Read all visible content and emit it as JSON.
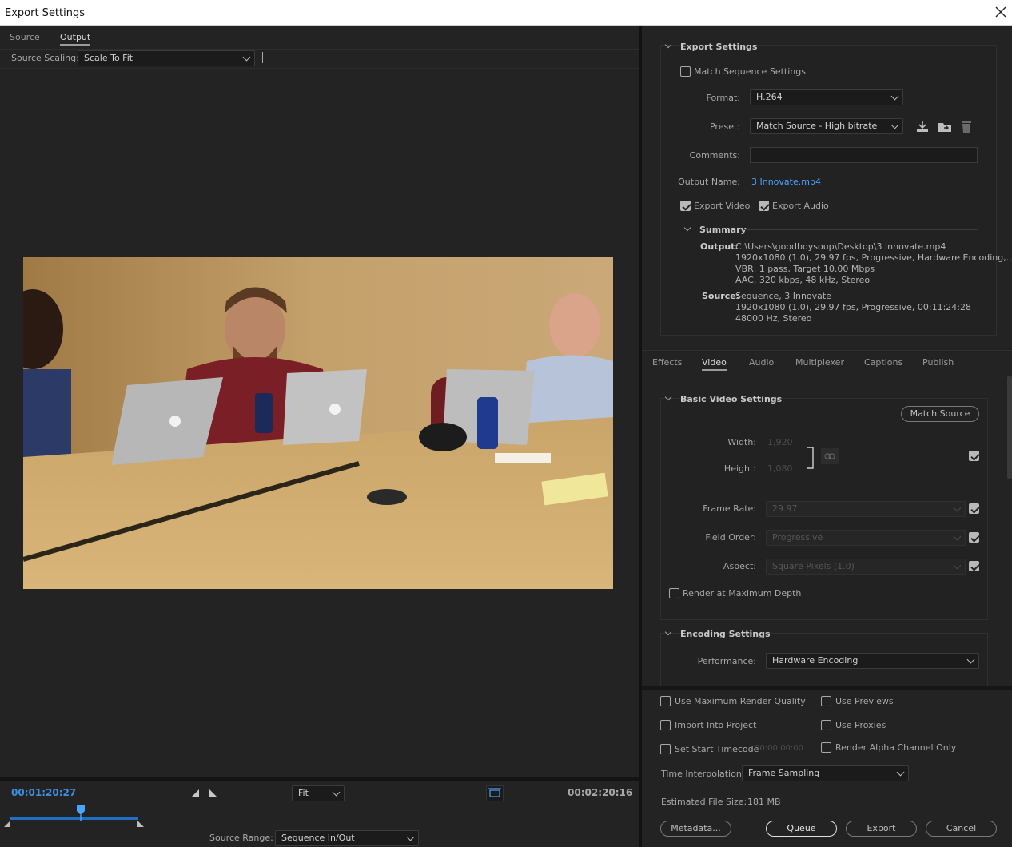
{
  "window": {
    "title": "Export Settings"
  },
  "left": {
    "tabs": [
      {
        "label": "Source",
        "active": false
      },
      {
        "label": "Output",
        "active": true
      }
    ],
    "source_scaling_label": "Source Scaling:",
    "source_scaling_value": "Scale To Fit",
    "timecode_current": "00:01:20:27",
    "timecode_end": "00:02:20:16",
    "zoom_value": "Fit",
    "source_range_label": "Source Range:",
    "source_range_value": "Sequence In/Out",
    "playhead_fraction": 0.55
  },
  "export_settings": {
    "title": "Export Settings",
    "match_sequence_label": "Match Sequence Settings",
    "match_sequence_checked": false,
    "format_label": "Format:",
    "format_value": "H.264",
    "preset_label": "Preset:",
    "preset_value": "Match Source - High bitrate",
    "comments_label": "Comments:",
    "comments_value": "",
    "output_name_label": "Output Name:",
    "output_name_value": "3 Innovate.mp4",
    "export_video_label": "Export Video",
    "export_video_checked": true,
    "export_audio_label": "Export Audio",
    "export_audio_checked": true,
    "summary_title": "Summary",
    "summary_output_key": "Output:",
    "summary_output_lines": [
      "C:\\Users\\goodboysoup\\Desktop\\3 Innovate.mp4",
      "1920x1080 (1.0), 29.97 fps, Progressive, Hardware Encoding,...",
      "VBR, 1 pass, Target 10.00 Mbps",
      "AAC, 320 kbps, 48 kHz, Stereo"
    ],
    "summary_source_key": "Source:",
    "summary_source_lines": [
      "Sequence, 3 Innovate",
      "1920x1080 (1.0), 29.97 fps, Progressive, 00:11:24:28",
      "48000 Hz, Stereo"
    ]
  },
  "settings_tabs": [
    {
      "label": "Effects",
      "active": false
    },
    {
      "label": "Video",
      "active": true
    },
    {
      "label": "Audio",
      "active": false
    },
    {
      "label": "Multiplexer",
      "active": false
    },
    {
      "label": "Captions",
      "active": false
    },
    {
      "label": "Publish",
      "active": false
    }
  ],
  "basic_video": {
    "title": "Basic Video Settings",
    "match_source_label": "Match Source",
    "width_label": "Width:",
    "width_value": "1,920",
    "height_label": "Height:",
    "height_value": "1,080",
    "frame_rate_label": "Frame Rate:",
    "frame_rate_value": "29.97",
    "field_order_label": "Field Order:",
    "field_order_value": "Progressive",
    "aspect_label": "Aspect:",
    "aspect_value": "Square Pixels (1.0)",
    "render_max_depth_label": "Render at Maximum Depth",
    "render_max_depth_checked": false
  },
  "encoding": {
    "title": "Encoding Settings",
    "performance_label": "Performance:",
    "performance_value": "Hardware Encoding"
  },
  "bottom": {
    "use_max_render_quality": "Use Maximum Render Quality",
    "use_previews": "Use Previews",
    "import_into_project": "Import Into Project",
    "use_proxies": "Use Proxies",
    "set_start_timecode": "Set Start Timecode",
    "start_timecode_value": "00:00:00:00",
    "render_alpha_only": "Render Alpha Channel Only",
    "time_interpolation_label": "Time Interpolation:",
    "time_interpolation_value": "Frame Sampling",
    "estimated_size_label": "Estimated File Size:",
    "estimated_size_value": "181 MB",
    "metadata_label": "Metadata...",
    "queue_label": "Queue",
    "export_label": "Export",
    "cancel_label": "Cancel"
  },
  "colors": {
    "accent": "#3b8fe0",
    "link": "#4aa3ff",
    "panel": "#232323"
  }
}
